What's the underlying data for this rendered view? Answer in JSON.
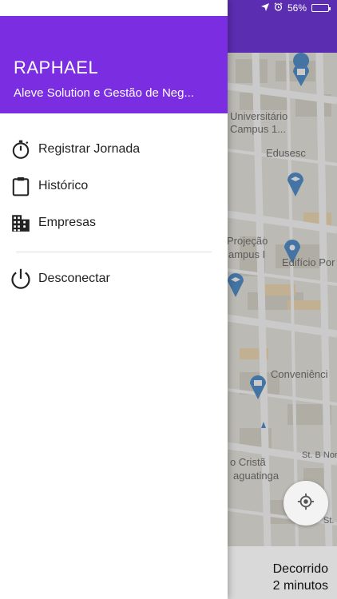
{
  "status_bar": {
    "battery_percent": "56%",
    "battery_level": 0.56,
    "icons": [
      "location-arrow-icon",
      "alarm-icon",
      "battery-icon"
    ]
  },
  "map": {
    "labels": [
      {
        "text": "Universitário",
        "id": "l1"
      },
      {
        "text": "- Campus 1...",
        "id": "l2"
      },
      {
        "text": "Edusesc",
        "id": "l3"
      },
      {
        "text": "Projeção",
        "id": "l4"
      },
      {
        "text": "ampus I",
        "id": "l5"
      },
      {
        "text": "Edifício Por",
        "id": "l6"
      },
      {
        "text": "Conveniênci",
        "id": "l7"
      },
      {
        "text": "o Cristã",
        "id": "l8"
      },
      {
        "text": "aguatinga",
        "id": "l9"
      },
      {
        "text": "St. B Nor",
        "id": "l10"
      },
      {
        "text": "St. I",
        "id": "l11"
      }
    ]
  },
  "elapsed": {
    "label": "Decorrido",
    "value": "2 minutos"
  },
  "drawer": {
    "user_name": "RAPHAEL",
    "company": "Aleve Solution e Gestão de Neg...",
    "menu": [
      {
        "label": "Registrar Jornada",
        "icon": "stopwatch-icon"
      },
      {
        "label": "Histórico",
        "icon": "clipboard-icon"
      },
      {
        "label": "Empresas",
        "icon": "building-icon"
      }
    ],
    "logout": {
      "label": "Desconectar",
      "icon": "power-icon"
    }
  },
  "colors": {
    "drawer_header": "#7b2de2",
    "app_bar": "#5b2db0"
  }
}
